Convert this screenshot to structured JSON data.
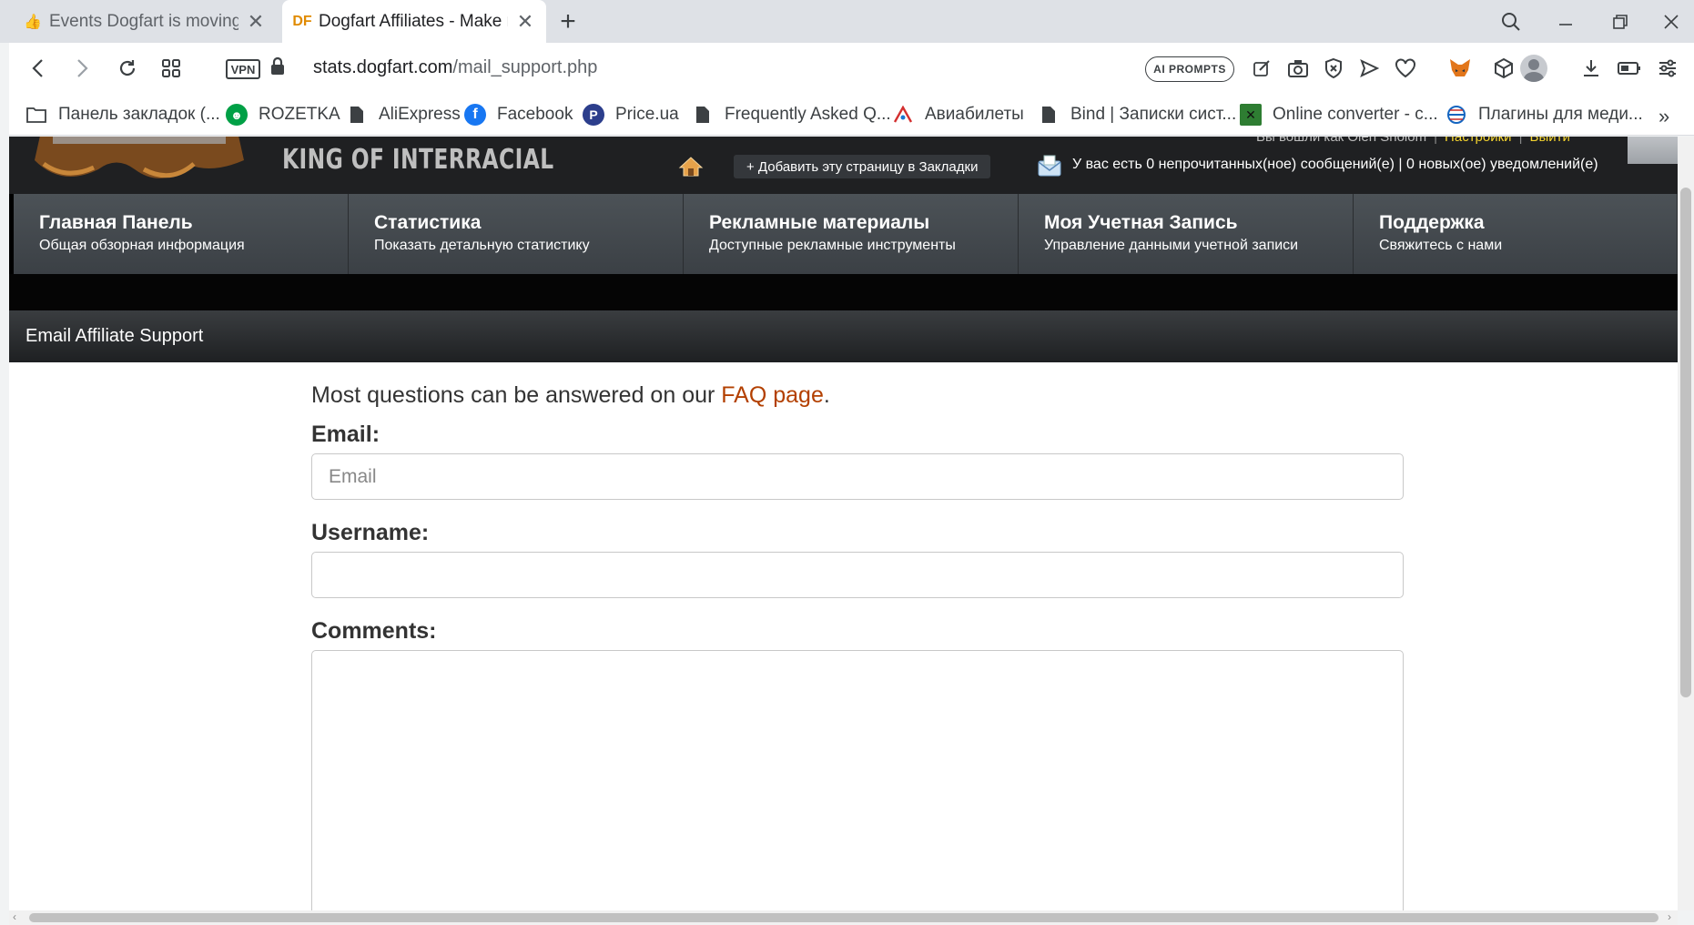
{
  "browser": {
    "tabs": [
      {
        "title": "Events Dogfart is moving to",
        "active": false
      },
      {
        "title": "Dogfart Affiliates - Make m",
        "active": true
      }
    ],
    "url_host": "stats.dogfart.com",
    "url_path": "/mail_support.php",
    "vpn_label": "VPN",
    "ai_prompts_label": "AI PROMPTS",
    "df_favicon": "DF",
    "bookmarks": [
      {
        "label": "Панель закладок (...",
        "icon": "folder-icon"
      },
      {
        "label": "ROZETKA",
        "icon": "rozetka-icon"
      },
      {
        "label": "AliExpress",
        "icon": "page-icon"
      },
      {
        "label": "Facebook",
        "icon": "facebook-icon"
      },
      {
        "label": "Price.ua",
        "icon": "priceua-icon"
      },
      {
        "label": "Frequently Asked Q...",
        "icon": "page-icon"
      },
      {
        "label": "Авиабилеты",
        "icon": "avia-icon"
      },
      {
        "label": "Bind | Записки сист...",
        "icon": "page-icon"
      },
      {
        "label": "Online converter - c...",
        "icon": "converter-icon"
      },
      {
        "label": "Плагины для меди...",
        "icon": "globe-icon"
      }
    ]
  },
  "header": {
    "logo_text": "KING OF INTERRACIAL",
    "logged_in_as": "Вы вошли как Oleh Sholom",
    "settings_link": "Настройки",
    "logout_link": "Выйти",
    "bookmark_button": "+ Добавить эту страницу в Закладки",
    "messages": "У вас есть 0 непрочитанных(ное) сообщений(е) | 0 новых(ое) уведомлений(е)"
  },
  "nav": [
    {
      "title": "Главная Панель",
      "subtitle": "Общая обзорная информация"
    },
    {
      "title": "Статистика",
      "subtitle": "Показать детальную статистику"
    },
    {
      "title": "Рекламные материалы",
      "subtitle": "Доступные рекламные инструменты"
    },
    {
      "title": "Моя Учетная Запись",
      "subtitle": "Управление данными учетной записи"
    },
    {
      "title": "Поддержка",
      "subtitle": "Свяжитесь с нами"
    }
  ],
  "section_title": "Email Affiliate Support",
  "form": {
    "intro_before": "Most questions can be answered on our ",
    "intro_link": "FAQ page",
    "intro_after": ".",
    "email_label": "Email:",
    "email_placeholder": "Email",
    "email_value": "",
    "username_label": "Username:",
    "username_value": "",
    "comments_label": "Comments:",
    "comments_value": ""
  },
  "colors": {
    "link": "#b34000",
    "header_bg": "#1f2022",
    "nav_bg": "#4c5257"
  }
}
